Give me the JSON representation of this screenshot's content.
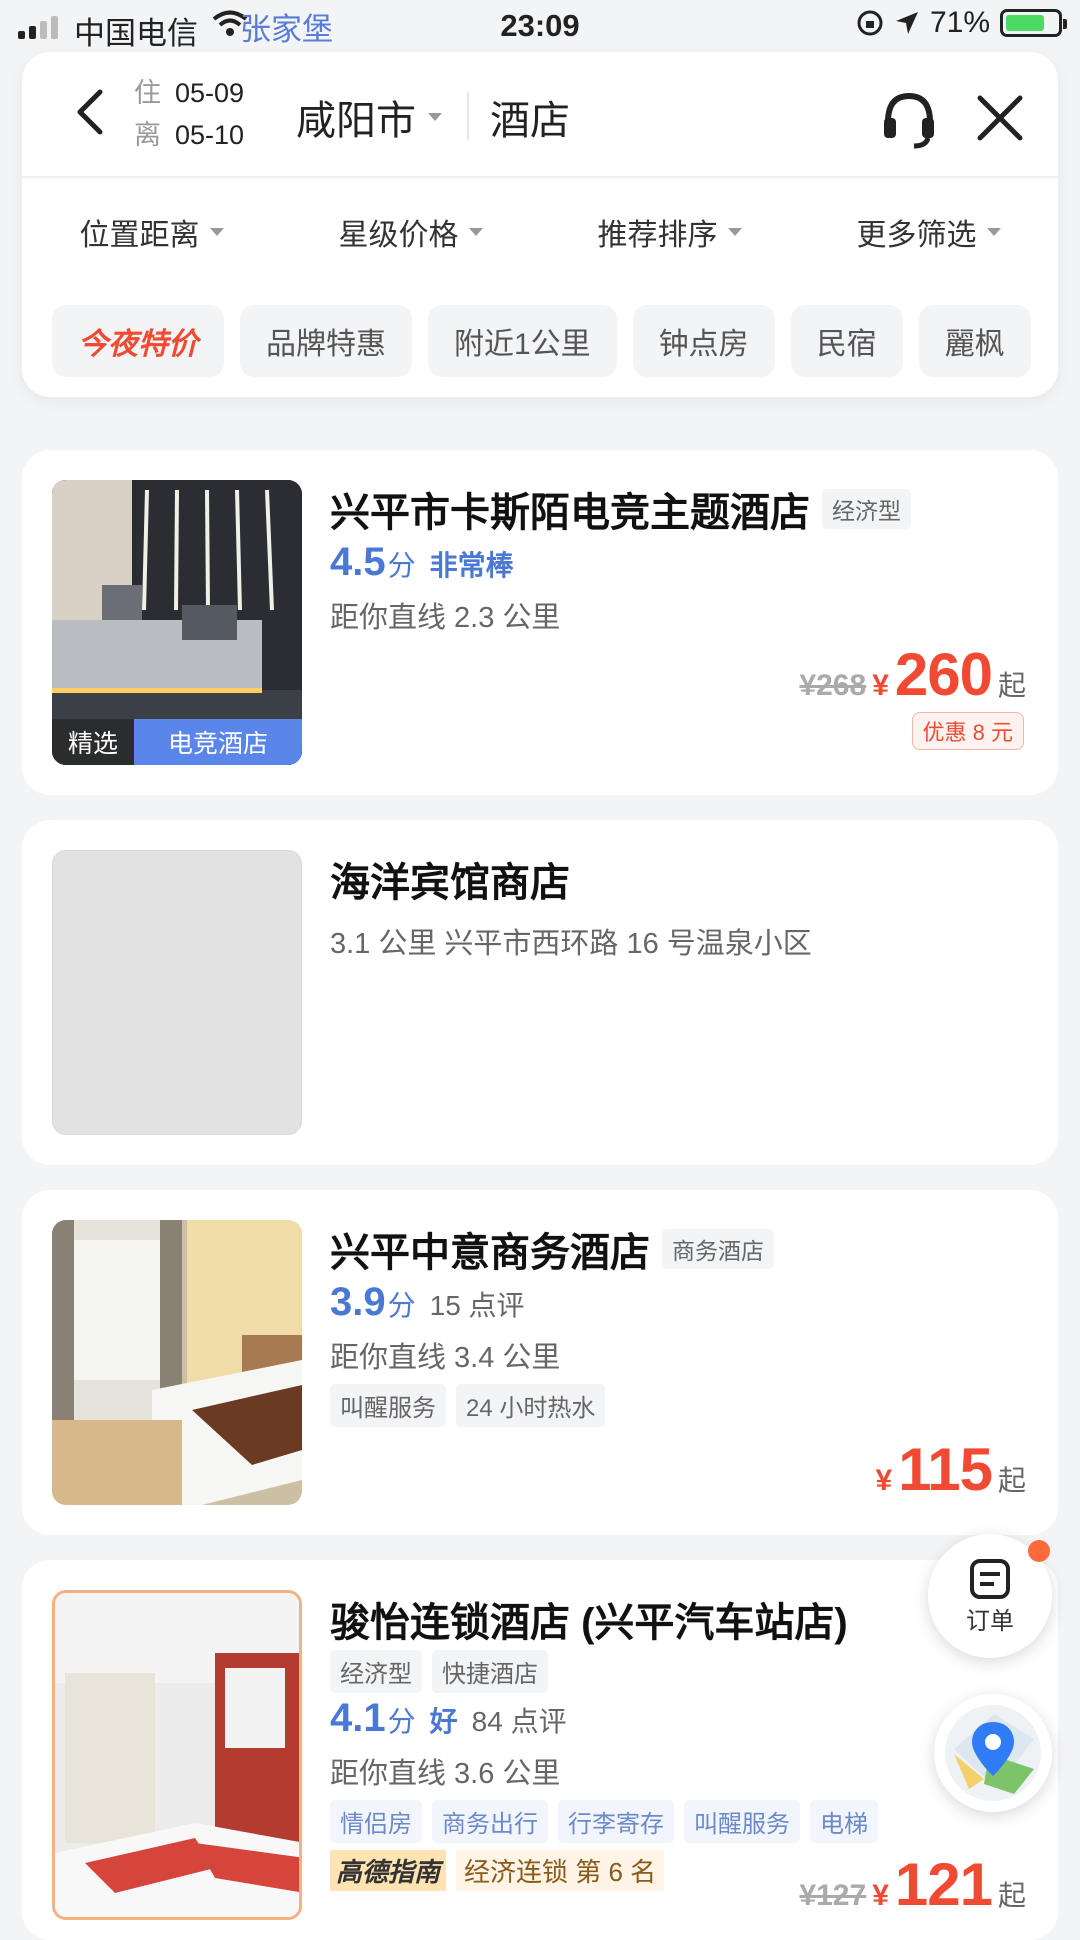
{
  "status_bar": {
    "carrier": "中国电信",
    "overlay_location": "张家堡",
    "time": "23:09",
    "battery": "71%"
  },
  "header": {
    "checkin_label": "住",
    "checkin_date": "05-09",
    "checkout_label": "离",
    "checkout_date": "05-10",
    "city": "咸阳市",
    "keyword": "酒店"
  },
  "filters": [
    "位置距离",
    "星级价格",
    "推荐排序",
    "更多筛选"
  ],
  "chips": [
    "今夜特价",
    "品牌特惠",
    "附近1公里",
    "钟点房",
    "民宿",
    "麗枫"
  ],
  "hotels": [
    {
      "name": "兴平市卡斯陌电竞主题酒店",
      "type_tag": "经济型",
      "score": "4.5",
      "score_unit": "分",
      "score_word": "非常棒",
      "distance": "距你直线 2.3 公里",
      "badge_left": "精选",
      "badge_right": "电竞酒店",
      "old_price": "¥268",
      "yen": "¥",
      "price": "260",
      "suffix": "起",
      "discount": "优惠 8 元"
    },
    {
      "name": "海洋宾馆商店",
      "address": "3.1 公里   兴平市西环路 16 号温泉小区"
    },
    {
      "name": "兴平中意商务酒店",
      "type_tag": "商务酒店",
      "score": "3.9",
      "score_unit": "分",
      "reviews": "15 点评",
      "distance": "距你直线 3.4 公里",
      "tags": [
        "叫醒服务",
        "24 小时热水"
      ],
      "yen": "¥",
      "price": "115",
      "suffix": "起"
    },
    {
      "name": "骏怡连锁酒店 (兴平汽车站店)",
      "type_tags": [
        "经济型",
        "快捷酒店"
      ],
      "score": "4.1",
      "score_unit": "分",
      "score_word": "好",
      "reviews": "84 点评",
      "distance": "距你直线 3.6 公里",
      "tags": [
        "情侣房",
        "商务出行",
        "行李寄存",
        "叫醒服务",
        "电梯"
      ],
      "rank_brand": "高德指南",
      "rank_text": "经济连锁 第 6 名",
      "old_price": "¥127",
      "yen": "¥",
      "price": "121",
      "suffix": "起"
    }
  ],
  "float": {
    "order_label": "订单"
  }
}
